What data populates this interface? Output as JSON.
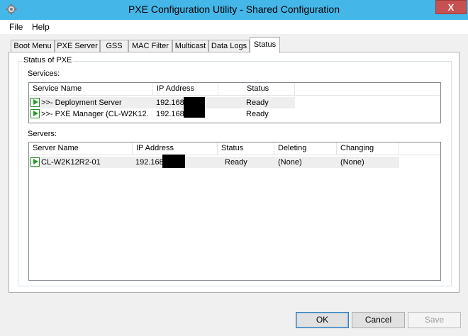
{
  "window": {
    "title": "PXE Configuration Utility - Shared Configuration",
    "close_label": "X"
  },
  "menu": {
    "items": [
      "File",
      "Help"
    ]
  },
  "tabs": [
    {
      "label": "Boot Menu"
    },
    {
      "label": "PXE Server"
    },
    {
      "label": "GSS"
    },
    {
      "label": "MAC Filter"
    },
    {
      "label": "Multicast"
    },
    {
      "label": "Data Logs"
    },
    {
      "label": "Status",
      "active": true
    }
  ],
  "status_group": {
    "title": "Status of PXE"
  },
  "services": {
    "label": "Services:",
    "columns": [
      "Service Name",
      "IP Address",
      "Status"
    ],
    "rows": [
      {
        "name": ">>- Deployment Server",
        "ip": "192.168",
        "status": "Ready"
      },
      {
        "name": ">>- PXE Manager (CL-W2K12...",
        "ip": "192.168",
        "status": "Ready"
      }
    ]
  },
  "servers": {
    "label": "Servers:",
    "columns": [
      "Server Name",
      "IP Address",
      "Status",
      "Deleting",
      "Changing"
    ],
    "rows": [
      {
        "name": "CL-W2K12R2-01",
        "ip": "192.168",
        "status": "Ready",
        "deleting": "(None)",
        "changing": "(None)"
      }
    ]
  },
  "buttons": {
    "ok": "OK",
    "cancel": "Cancel",
    "save": "Save"
  }
}
